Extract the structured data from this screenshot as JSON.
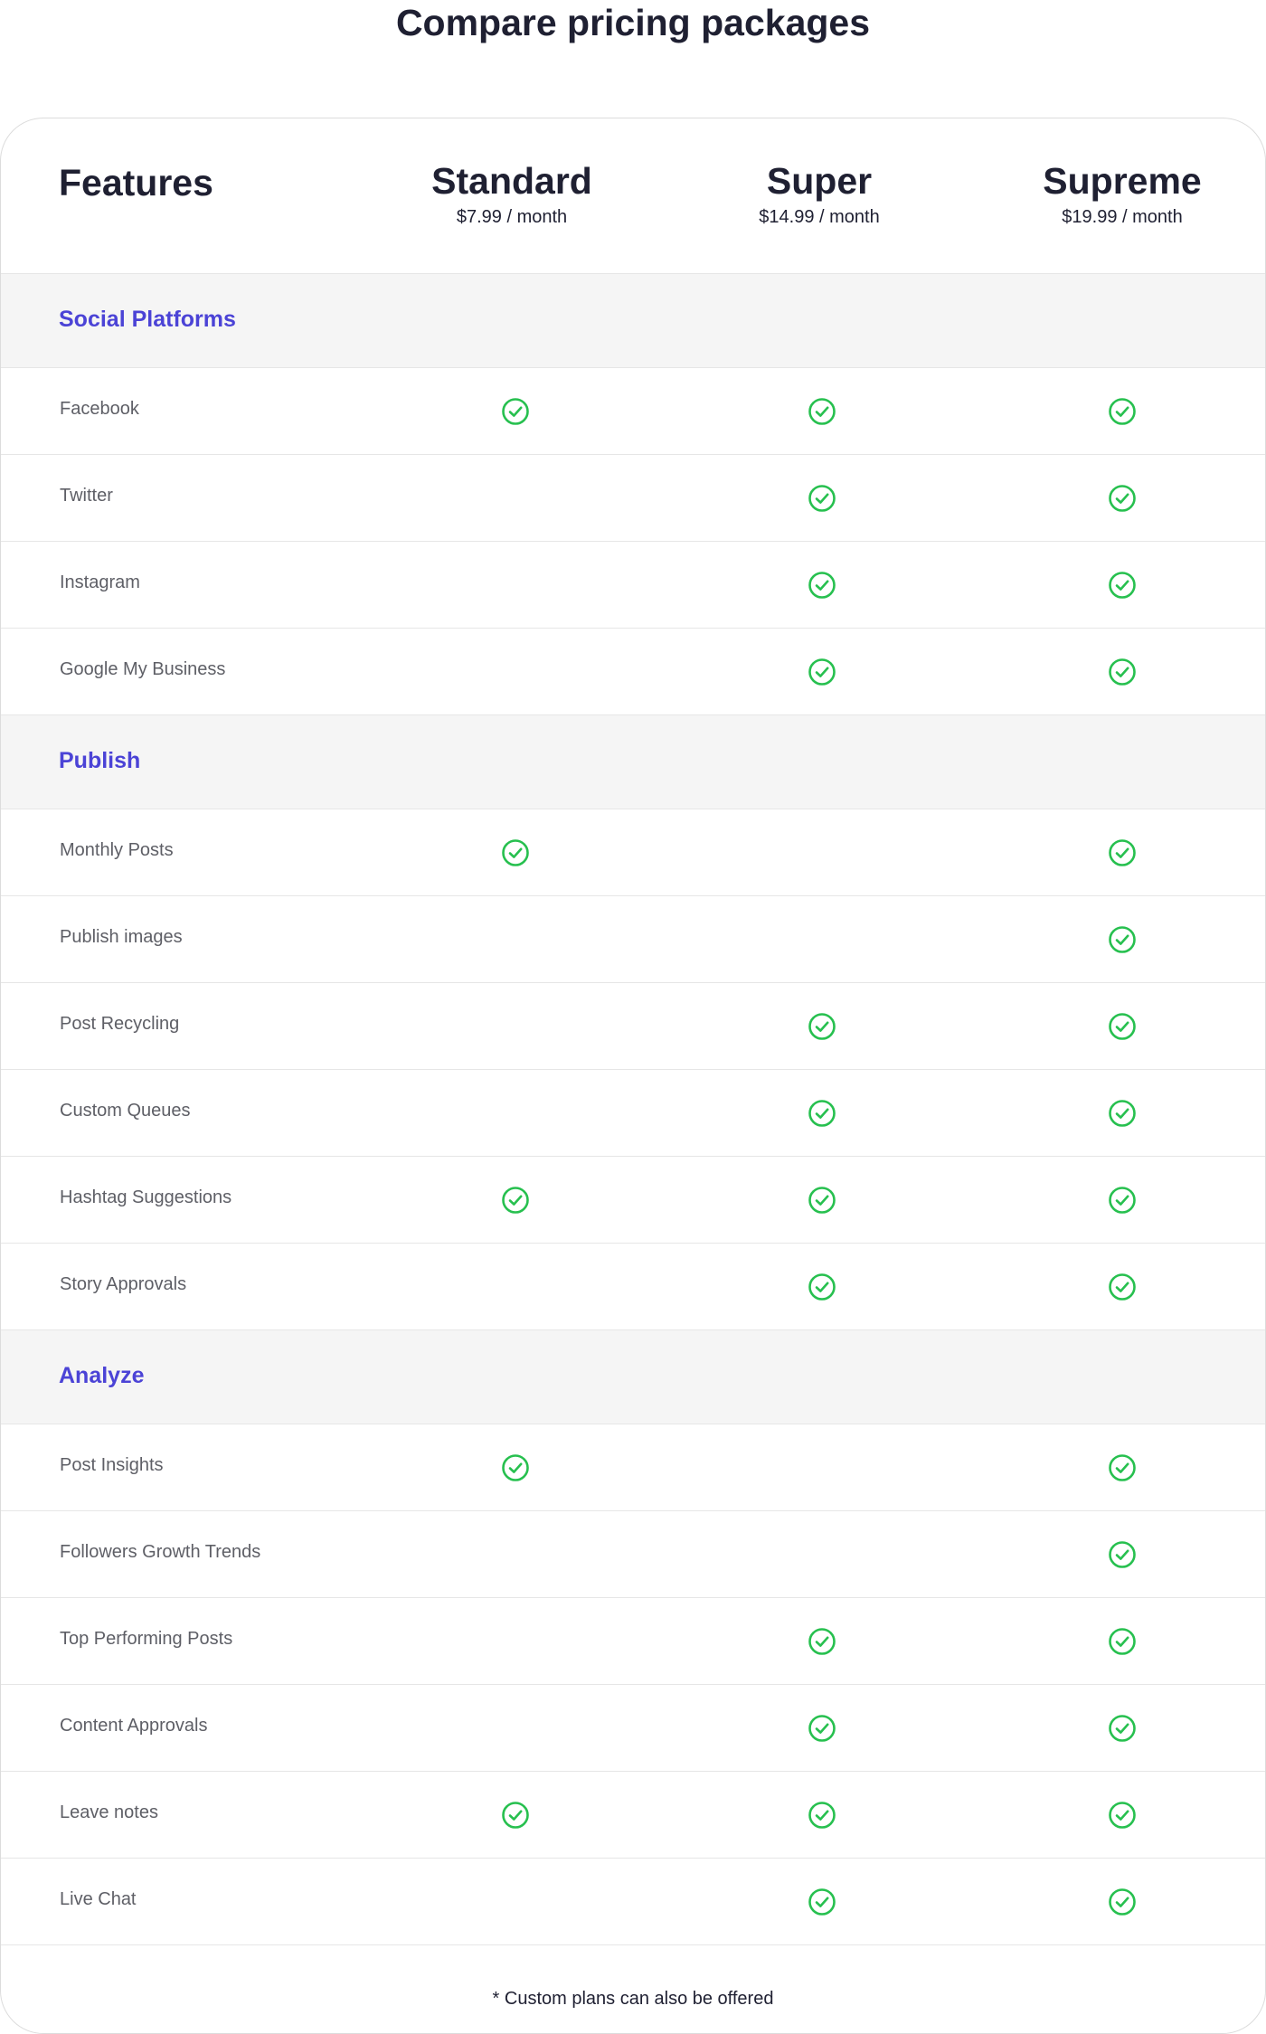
{
  "page": {
    "title": "Compare pricing packages"
  },
  "header": {
    "features_label": "Features",
    "plans": [
      {
        "name": "Standard",
        "price": "$7.99 / month"
      },
      {
        "name": "Super",
        "price": "$14.99 / month"
      },
      {
        "name": "Supreme",
        "price": "$19.99 / month"
      }
    ]
  },
  "sections": [
    {
      "title": "Social Platforms",
      "rows": [
        {
          "label": "Facebook",
          "standard": true,
          "super": true,
          "supreme": true
        },
        {
          "label": "Twitter",
          "standard": false,
          "super": true,
          "supreme": true
        },
        {
          "label": "Instagram",
          "standard": false,
          "super": true,
          "supreme": true
        },
        {
          "label": "Google My Business",
          "standard": false,
          "super": true,
          "supreme": true
        }
      ]
    },
    {
      "title": "Publish",
      "rows": [
        {
          "label": "Monthly Posts",
          "standard": true,
          "super": false,
          "supreme": true
        },
        {
          "label": "Publish images",
          "standard": false,
          "super": false,
          "supreme": true
        },
        {
          "label": "Post Recycling",
          "standard": false,
          "super": true,
          "supreme": true
        },
        {
          "label": "Custom Queues",
          "standard": false,
          "super": true,
          "supreme": true
        },
        {
          "label": "Hashtag Suggestions",
          "standard": true,
          "super": true,
          "supreme": true
        },
        {
          "label": "Story Approvals",
          "standard": false,
          "super": true,
          "supreme": true
        }
      ]
    },
    {
      "title": "Analyze",
      "rows": [
        {
          "label": "Post Insights",
          "standard": true,
          "super": false,
          "supreme": true
        },
        {
          "label": "Followers Growth Trends",
          "standard": false,
          "super": false,
          "supreme": true
        },
        {
          "label": "Top Performing Posts",
          "standard": false,
          "super": true,
          "supreme": true
        },
        {
          "label": "Content Approvals",
          "standard": false,
          "super": true,
          "supreme": true
        },
        {
          "label": "Leave notes",
          "standard": true,
          "super": true,
          "supreme": true
        },
        {
          "label": "Live Chat",
          "standard": false,
          "super": true,
          "supreme": true
        }
      ]
    }
  ],
  "footnote": "* Custom plans can also be offered",
  "colors": {
    "accent": "#4b43d6",
    "check": "#27c04f",
    "section_bg": "#f5f5f5",
    "text_dark": "#1f2032",
    "text_muted": "#5e5f66"
  },
  "icons": {
    "check": "check-circle-icon"
  }
}
